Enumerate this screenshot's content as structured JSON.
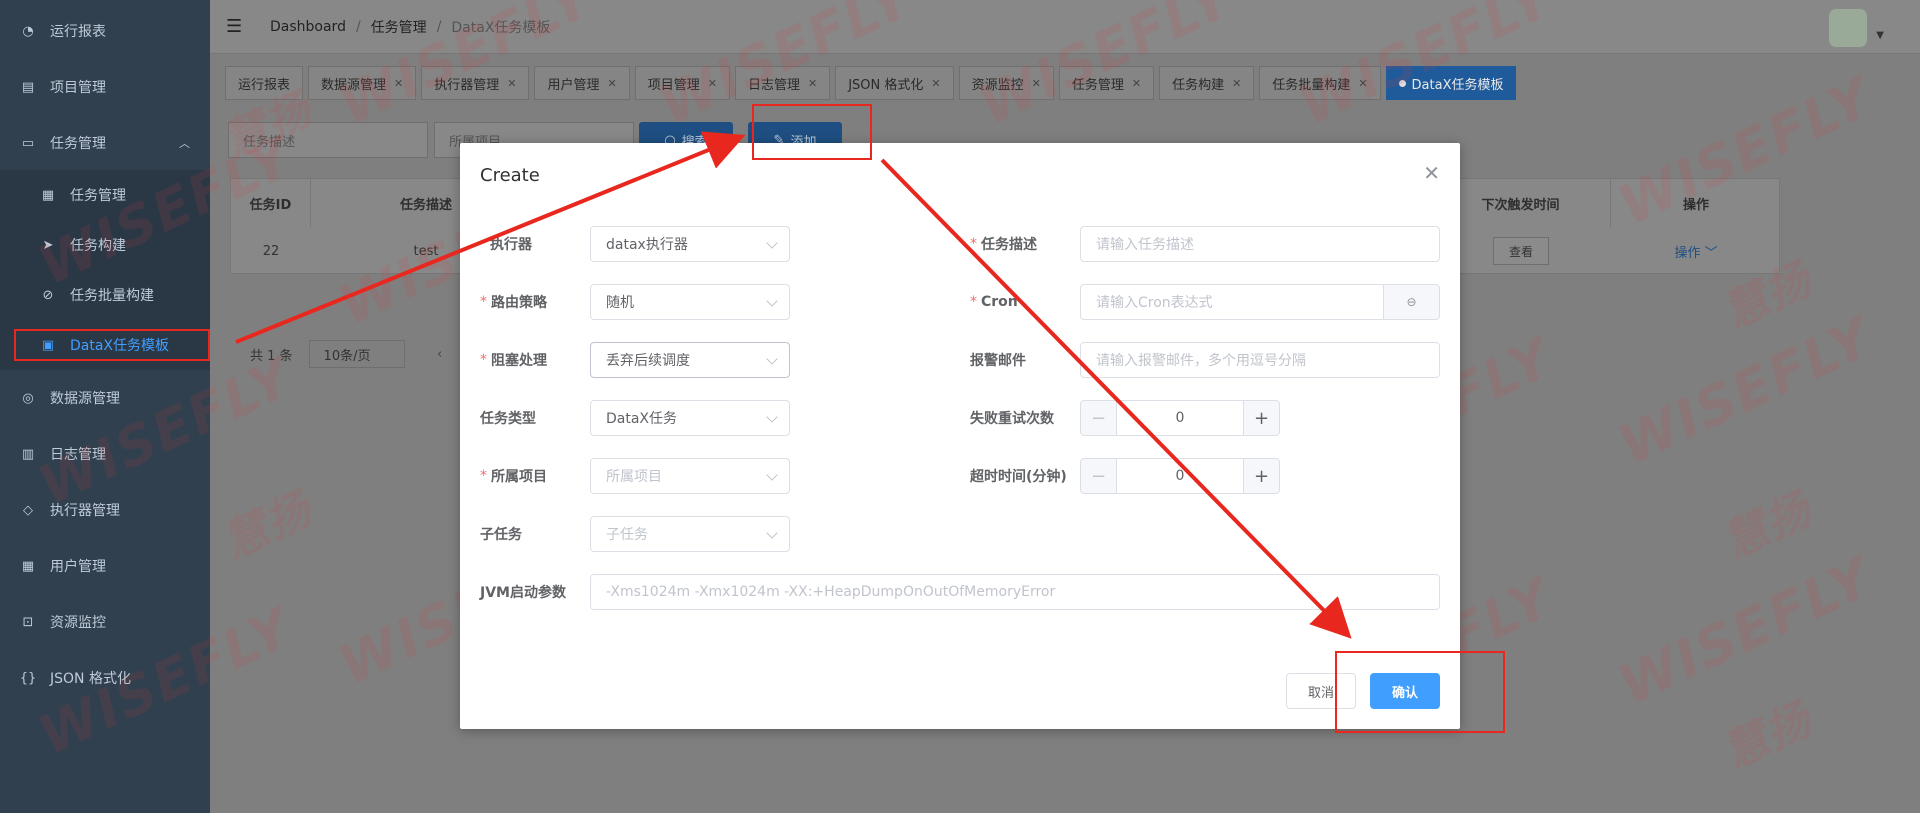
{
  "sidebar": {
    "items": [
      {
        "label": "运行报表",
        "icon": "dashboard-icon"
      },
      {
        "label": "项目管理",
        "icon": "project-icon"
      },
      {
        "label": "任务管理",
        "icon": "monitor-icon"
      },
      {
        "label": "任务管理",
        "icon": "calendar-icon"
      },
      {
        "label": "任务构建",
        "icon": "send-icon"
      },
      {
        "label": "任务批量构建",
        "icon": "batch-icon"
      },
      {
        "label": "DataX任务模板",
        "icon": "template-icon"
      },
      {
        "label": "数据源管理",
        "icon": "database-icon"
      },
      {
        "label": "日志管理",
        "icon": "log-icon"
      },
      {
        "label": "执行器管理",
        "icon": "executor-icon"
      },
      {
        "label": "用户管理",
        "icon": "user-grid-icon"
      },
      {
        "label": "资源监控",
        "icon": "resource-icon"
      },
      {
        "label": "JSON 格式化",
        "icon": "braces-icon"
      }
    ]
  },
  "navbar": {
    "breadcrumb": [
      "Dashboard",
      "任务管理",
      "DataX任务模板"
    ]
  },
  "tags": [
    {
      "label": "运行报表",
      "closable": false
    },
    {
      "label": "数据源管理",
      "closable": true
    },
    {
      "label": "执行器管理",
      "closable": true
    },
    {
      "label": "用户管理",
      "closable": true
    },
    {
      "label": "项目管理",
      "closable": true
    },
    {
      "label": "日志管理",
      "closable": true
    },
    {
      "label": "JSON 格式化",
      "closable": true
    },
    {
      "label": "资源监控",
      "closable": true
    },
    {
      "label": "任务管理",
      "closable": true
    },
    {
      "label": "任务构建",
      "closable": true
    },
    {
      "label": "任务批量构建",
      "closable": true
    },
    {
      "label": "DataX任务模板",
      "closable": true,
      "active": true
    }
  ],
  "filters": {
    "desc_placeholder": "任务描述",
    "project_placeholder": "所属项目",
    "search_label": "搜索",
    "add_label": "添加"
  },
  "table": {
    "headers": [
      "任务ID",
      "任务描述",
      "下次触发时间",
      "操作"
    ],
    "row": {
      "id": "22",
      "desc": "test",
      "view": "查看",
      "op": "操作"
    }
  },
  "pager": {
    "total": "共 1 条",
    "size": "10条/页"
  },
  "watermark": {
    "brand": "WISEFLY",
    "cn": "慧扬"
  },
  "dialog": {
    "title": "Create",
    "labels": {
      "executor": "执行器",
      "route": "路由策略",
      "block": "阻塞处理",
      "task_type": "任务类型",
      "project": "所属项目",
      "child": "子任务",
      "jvm": "JVM启动参数",
      "desc": "任务描述",
      "cron": "Cron",
      "email": "报警邮件",
      "retry": "失败重试次数",
      "timeout": "超时时间(分钟)"
    },
    "values": {
      "executor": "datax执行器",
      "route": "随机",
      "block": "丢弃后续调度",
      "task_type": "DataX任务",
      "retry": "0",
      "timeout": "0"
    },
    "placeholders": {
      "project": "所属项目",
      "child": "子任务",
      "jvm": "-Xms1024m -Xmx1024m -XX:+HeapDumpOnOutOfMemoryError",
      "desc": "请输入任务描述",
      "cron": "请输入Cron表达式",
      "email": "请输入报警邮件，多个用逗号分隔"
    },
    "cancel_label": "取消",
    "confirm_label": "确认"
  },
  "colors": {
    "primary": "#409eff",
    "annotation": "#e8281e",
    "sidebar": "#30404f"
  }
}
